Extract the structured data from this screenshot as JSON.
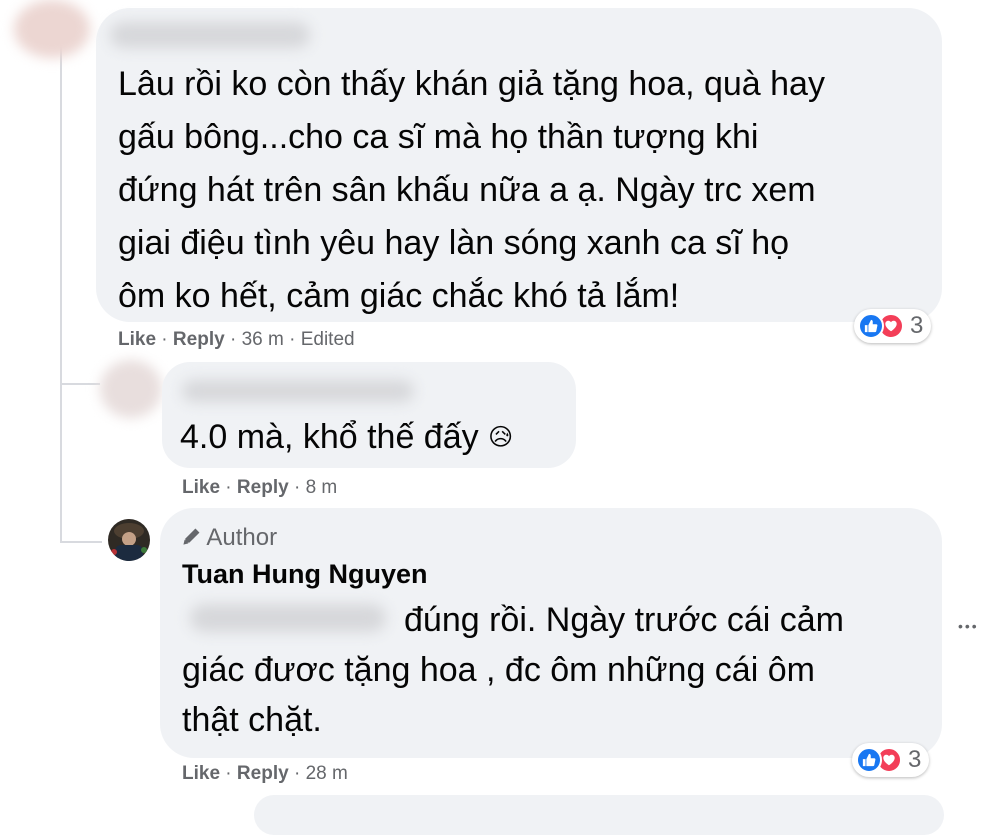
{
  "comments": [
    {
      "author": "",
      "lines": [
        "Lâu rồi ko còn thấy khán giả tặng hoa, quà hay",
        "gấu bông...cho ca sĩ mà họ thần tượng khi",
        "đứng hát trên sân khấu nữa a ạ. Ngày trc xem",
        "giai điệu tình yêu hay làn sóng xanh ca sĩ họ",
        "ôm ko hết, cảm giác chắc khó tả lắm!"
      ],
      "like": "Like",
      "reply": "Reply",
      "time": "36 m",
      "edited": "Edited",
      "reaction_count": "3",
      "sep": " · "
    },
    {
      "author": "",
      "text": "4.0 mà, khổ thế đấy",
      "emoji": "😥",
      "like": "Like",
      "reply": "Reply",
      "time": "8 m",
      "sep": " · "
    },
    {
      "badge": "Author",
      "author": "Tuan Hung Nguyen",
      "line1_rest": "đúng rồi. Ngày trước cái cảm",
      "line2": "giác đươc tặng hoa , đc ôm những cái ôm",
      "line3": "thật chặt.",
      "like": "Like",
      "reply": "Reply",
      "time": "28 m",
      "reaction_count": "3",
      "sep": " · "
    }
  ],
  "more_options": "•••",
  "colors": {
    "bubble": "#f0f2f5",
    "meta_text": "#65676b",
    "like_blue": "#1877f2",
    "love_red": "#f33e58"
  }
}
